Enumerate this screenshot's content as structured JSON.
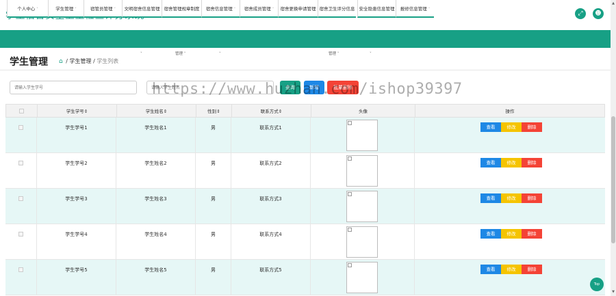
{
  "app": {
    "title": "学生宿舍安全卫生检查评分系统"
  },
  "header": {
    "fullscreen_icon": "fullscreen-icon",
    "user_icon": "user-icon"
  },
  "nav": {
    "items": [
      {
        "label": "个人中心",
        "caret": "˅"
      },
      {
        "label": "学生管理",
        "caret": "˅"
      },
      {
        "label": "宿管员管理",
        "caret": "˅"
      },
      {
        "label": "文明宿舍信息管理",
        "caret": ""
      },
      {
        "label": "宿舍管理规章制度",
        "caret": ""
      },
      {
        "label": "宿舍信息管理",
        "caret": "˅"
      },
      {
        "label": "宿舍成员管理",
        "caret": "˅"
      },
      {
        "label": "宿舍更换申请管理",
        "caret": ""
      },
      {
        "label": "宿舍卫生评分信息",
        "caret": ""
      },
      {
        "label": "安全隐患信息管理",
        "caret": ""
      },
      {
        "label": "报修信息管理",
        "caret": "˅"
      }
    ],
    "sub_labels": [
      "˅",
      "管理 ˅",
      "˅",
      "管理 ˅",
      "˅"
    ]
  },
  "page": {
    "title": "学生管理",
    "breadcrumb": {
      "home_icon": "home-icon",
      "part1": "学生管理",
      "sep": "/",
      "current": "学生列表"
    }
  },
  "search": {
    "sno_placeholder": "请输入学生学号",
    "sname_placeholder": "请输入学生姓名",
    "search_label": "查询",
    "add_label": "新增",
    "batch_delete_label": "批量删除"
  },
  "watermark": "https://www.huzhan.com/ishop39397",
  "table": {
    "headers": [
      "学生学号⇕",
      "学生姓名⇕",
      "性别⇕",
      "联系方式⇕",
      "头像",
      "操作"
    ],
    "rows": [
      {
        "sno": "学生学号1",
        "sname": "学生姓名1",
        "gender": "男",
        "contact": "联系方式1"
      },
      {
        "sno": "学生学号2",
        "sname": "学生姓名2",
        "gender": "男",
        "contact": "联系方式2"
      },
      {
        "sno": "学生学号3",
        "sname": "学生姓名3",
        "gender": "男",
        "contact": "联系方式3"
      },
      {
        "sno": "学生学号4",
        "sname": "学生姓名4",
        "gender": "男",
        "contact": "联系方式4"
      },
      {
        "sno": "学生学号5",
        "sname": "学生姓名5",
        "gender": "男",
        "contact": "联系方式5"
      }
    ],
    "actions": {
      "view": "查看",
      "edit": "修改",
      "delete": "删除"
    }
  },
  "top_button": "Top",
  "colors": {
    "primary": "#17a085",
    "blue": "#1e88e5",
    "yellow": "#f5c400",
    "red": "#f44336",
    "row_highlight": "#e6f7f6"
  }
}
